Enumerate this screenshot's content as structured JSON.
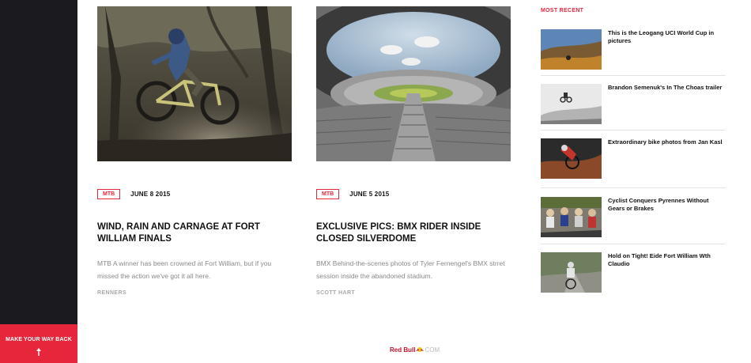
{
  "sidebar": {
    "back_label": "MAKE YOUR WAY BACK",
    "back_arrow": "↑"
  },
  "articles": [
    {
      "tag": "MTB",
      "date": "JUNE 8 2015",
      "title": "WIND, RAIN AND CARNAGE AT FORT WILLIAM FINALS",
      "excerpt": "MTB A winner has been crowned at Fort William, but if you missed the action we've got it all here.",
      "author": "RENNERS",
      "image": "mtb-rider-forest-photo"
    },
    {
      "tag": "MTB",
      "date": "JUNE 5 2015",
      "title": "EXCLUSIVE PICS: BMX RIDER INSIDE CLOSED SILVERDOME",
      "excerpt": "BMX Behind-the-scenes photos of Tyler Fernengel's BMX strret session inside the abandoned stadium.",
      "author": "SCOTT HART",
      "image": "stadium-photo"
    }
  ],
  "recent": {
    "heading": "MOST RECENT",
    "items": [
      {
        "title": "This is the Leogang UCI World Cup in pictures"
      },
      {
        "title": "Brandon Semenuk's In The Choas trailer"
      },
      {
        "title": "Extraordinary bike photos from Jan Kasl"
      },
      {
        "title": "Cyclist Conquers Pyrennes Without Gears or Brakes"
      },
      {
        "title": "Hold on Tight! Eide Fort William Wth Claudio"
      }
    ]
  },
  "footer": {
    "brand": "Red Bull",
    "brand_suffix": "COM"
  },
  "colors": {
    "accent": "#e6263b",
    "sidebar": "#1b1b1f"
  }
}
